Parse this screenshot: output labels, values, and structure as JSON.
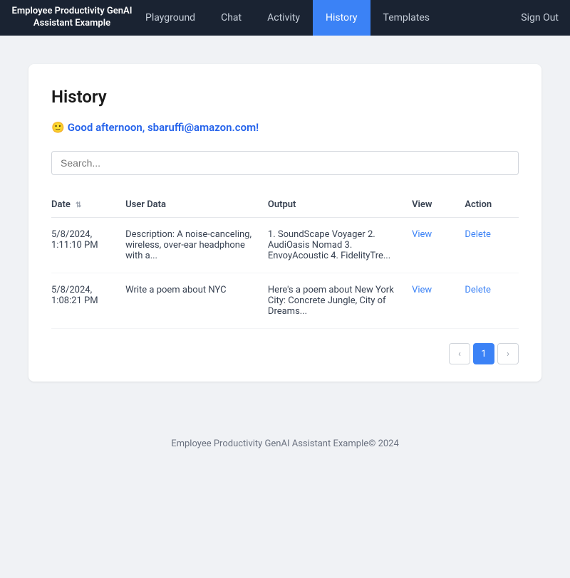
{
  "app": {
    "brand": "Employee Productivity GenAI Assistant Example"
  },
  "navbar": {
    "links": [
      {
        "id": "playground",
        "label": "Playground",
        "active": false
      },
      {
        "id": "chat",
        "label": "Chat",
        "active": false
      },
      {
        "id": "activity",
        "label": "Activity",
        "active": false
      },
      {
        "id": "history",
        "label": "History",
        "active": true
      },
      {
        "id": "templates",
        "label": "Templates",
        "active": false
      }
    ],
    "signout_label": "Sign Out"
  },
  "page": {
    "title": "History",
    "greeting_emoji": "🙂",
    "greeting_text": "Good afternoon, sbaruffi@amazon.com!"
  },
  "search": {
    "placeholder": "Search..."
  },
  "table": {
    "columns": [
      {
        "id": "date",
        "label": "Date",
        "sortable": true
      },
      {
        "id": "userdata",
        "label": "User Data",
        "sortable": false
      },
      {
        "id": "output",
        "label": "Output",
        "sortable": false
      },
      {
        "id": "view",
        "label": "View",
        "sortable": false
      },
      {
        "id": "action",
        "label": "Action",
        "sortable": false
      }
    ],
    "rows": [
      {
        "date": "5/8/2024, 1:11:10 PM",
        "userdata": "Description: A noise-canceling, wireless, over-ear headphone with a...",
        "output": "1. SoundScape Voyager 2. AudiOasis Nomad 3. EnvoyAcoustic 4. FidelityTre...",
        "view_label": "View",
        "delete_label": "Delete"
      },
      {
        "date": "5/8/2024, 1:08:21 PM",
        "userdata": "Write a poem about NYC",
        "output": "Here's a poem about New York City: Concrete Jungle, City of Dreams...",
        "view_label": "View",
        "delete_label": "Delete"
      }
    ]
  },
  "pagination": {
    "prev_label": "‹",
    "next_label": "›",
    "current_page": 1,
    "pages": [
      1
    ]
  },
  "footer": {
    "text": "Employee Productivity GenAI Assistant Example© 2024"
  }
}
